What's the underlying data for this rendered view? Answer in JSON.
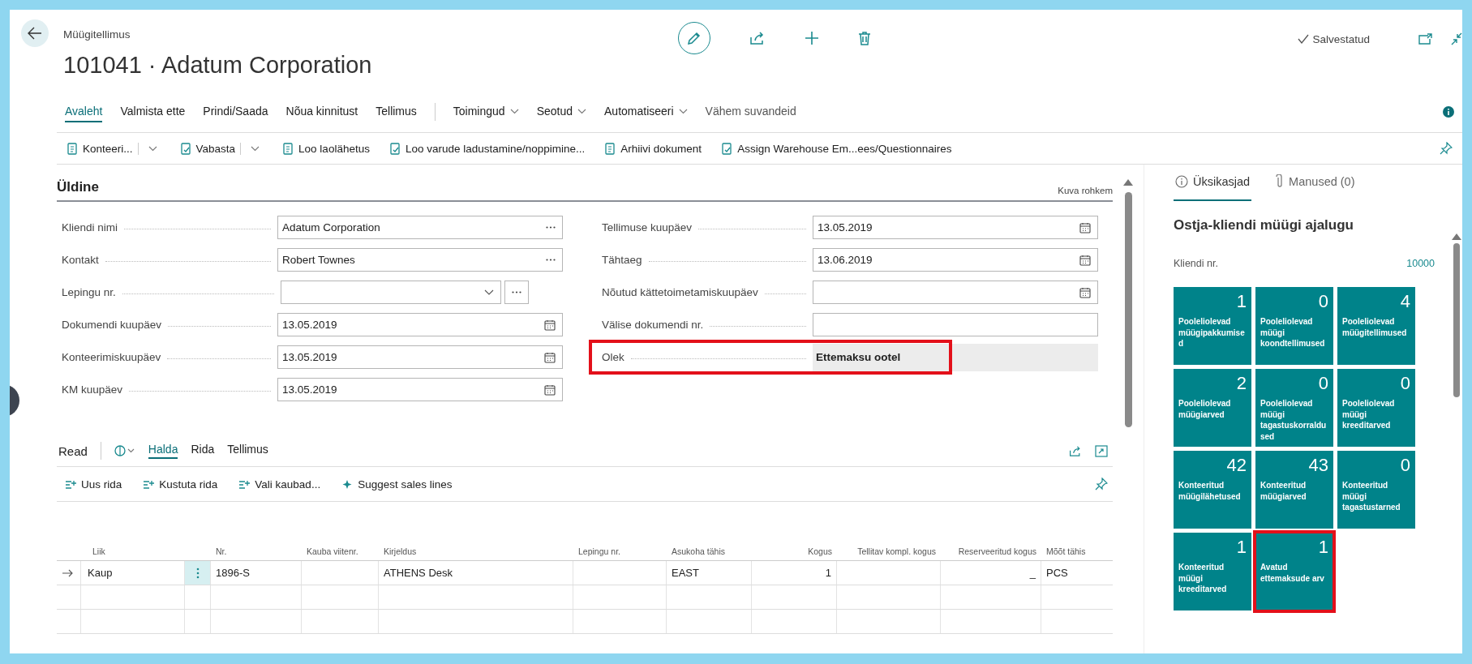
{
  "header": {
    "breadcrumb": "Müügitellimus",
    "title": "101041 · Adatum Corporation",
    "save_status": "Salvestatud"
  },
  "action_tabs": [
    {
      "label": "Avaleht",
      "kind": "tab",
      "selected": true
    },
    {
      "label": "Valmista ette",
      "kind": "tab",
      "selected": false
    },
    {
      "label": "Prindi/Saada",
      "kind": "tab",
      "selected": false
    },
    {
      "label": "Nõua kinnitust",
      "kind": "tab",
      "selected": false
    },
    {
      "label": "Tellimus",
      "kind": "tab",
      "selected": false
    },
    {
      "label": "Toimingud",
      "kind": "menu",
      "selected": false
    },
    {
      "label": "Seotud",
      "kind": "menu",
      "selected": false
    },
    {
      "label": "Automatiseeri",
      "kind": "menu",
      "selected": false
    },
    {
      "label": "Vähem suvandeid",
      "kind": "link",
      "selected": false
    }
  ],
  "action_bar": [
    {
      "label": "Konteeri...",
      "split": true
    },
    {
      "label": "Vabasta",
      "split": true
    },
    {
      "label": "Loo laolähetus",
      "split": false
    },
    {
      "label": "Loo varude ladustamine/noppimine...",
      "split": false
    },
    {
      "label": "Arhiivi dokument",
      "split": false
    },
    {
      "label": "Assign Warehouse Em...ees/Questionnaires",
      "split": false
    }
  ],
  "general": {
    "title": "Üldine",
    "show_more": "Kuva rohkem",
    "left": [
      {
        "label": "Kliendi nimi",
        "value": "Adatum Corporation",
        "kind": "lookup"
      },
      {
        "label": "Kontakt",
        "value": "Robert Townes",
        "kind": "lookup"
      },
      {
        "label": "Lepingu nr.",
        "kind": "dropdown"
      },
      {
        "label": "Dokumendi kuupäev",
        "value": "13.05.2019",
        "kind": "date"
      },
      {
        "label": "Konteerimiskuupäev",
        "value": "13.05.2019",
        "kind": "date"
      },
      {
        "label": "KM kuupäev",
        "value": "13.05.2019",
        "kind": "date"
      }
    ],
    "right": [
      {
        "label": "Tellimuse kuupäev",
        "value": "13.05.2019",
        "kind": "date"
      },
      {
        "label": "Tähtaeg",
        "value": "13.06.2019",
        "kind": "date"
      },
      {
        "label": "Nõutud kättetoimetamiskuupäev",
        "kind": "date"
      },
      {
        "label": "Välise dokumendi nr.",
        "kind": "text"
      },
      {
        "label": "Olek",
        "value": "Ettemaksu ootel",
        "kind": "status",
        "highlighted": true
      }
    ]
  },
  "lines": {
    "title": "Read",
    "tabs": [
      {
        "label": "Halda",
        "selected": true
      },
      {
        "label": "Rida",
        "selected": false
      },
      {
        "label": "Tellimus",
        "selected": false
      }
    ],
    "actions": [
      "Uus rida",
      "Kustuta rida",
      "Vali kaubad...",
      "Suggest sales lines"
    ],
    "columns": [
      {
        "label": "Liik",
        "kind": "text"
      },
      {
        "label": "Nr.",
        "kind": "text"
      },
      {
        "label": "Kauba viitenr.",
        "kind": "text"
      },
      {
        "label": "Kirjeldus",
        "kind": "text"
      },
      {
        "label": "Lepingu nr.",
        "kind": "text"
      },
      {
        "label": "Asukoha tähis",
        "kind": "text"
      },
      {
        "label": "Kogus",
        "kind": "number"
      },
      {
        "label": "Tellitav kompl. kogus",
        "kind": "number"
      },
      {
        "label": "Reserveeritud kogus",
        "kind": "number"
      },
      {
        "label": "Mõõt tähis",
        "kind": "text"
      }
    ],
    "rows": [
      {
        "current": true,
        "cells": [
          "Kaup",
          "1896-S",
          null,
          "ATHENS Desk",
          null,
          "EAST",
          "1",
          null,
          "_",
          "PCS"
        ]
      }
    ]
  },
  "factbox": {
    "tabs": [
      {
        "label": "Üksikasjad",
        "selected": true
      },
      {
        "label": "Manused (0)",
        "selected": false
      }
    ],
    "title": "Ostja-kliendi müügi ajalugu",
    "customer_label": "Kliendi nr.",
    "customer_no": "10000",
    "tiles": [
      {
        "value": "1",
        "label": "Pooleliolevad müügipakkumised",
        "highlighted": false
      },
      {
        "value": "0",
        "label": "Pooleliolevad müügi koondtellimused",
        "highlighted": false
      },
      {
        "value": "4",
        "label": "Pooleliolevad müügitellimused",
        "highlighted": false
      },
      {
        "value": "2",
        "label": "Pooleliolevad müügiarved",
        "highlighted": false
      },
      {
        "value": "0",
        "label": "Pooleliolevad müügi tagastuskorraldused",
        "highlighted": false
      },
      {
        "value": "0",
        "label": "Pooleliolevad müügi kreeditarved",
        "highlighted": false
      },
      {
        "value": "42",
        "label": "Konteeritud müügilähetused",
        "highlighted": false
      },
      {
        "value": "43",
        "label": "Konteeritud müügiarved",
        "highlighted": false
      },
      {
        "value": "0",
        "label": "Konteeritud müügi tagastustarned",
        "highlighted": false
      },
      {
        "value": "1",
        "label": "Konteeritud müügi kreeditarved",
        "highlighted": false
      },
      {
        "value": "1",
        "label": "Avatud ettemaksude arv",
        "highlighted": true
      }
    ]
  }
}
